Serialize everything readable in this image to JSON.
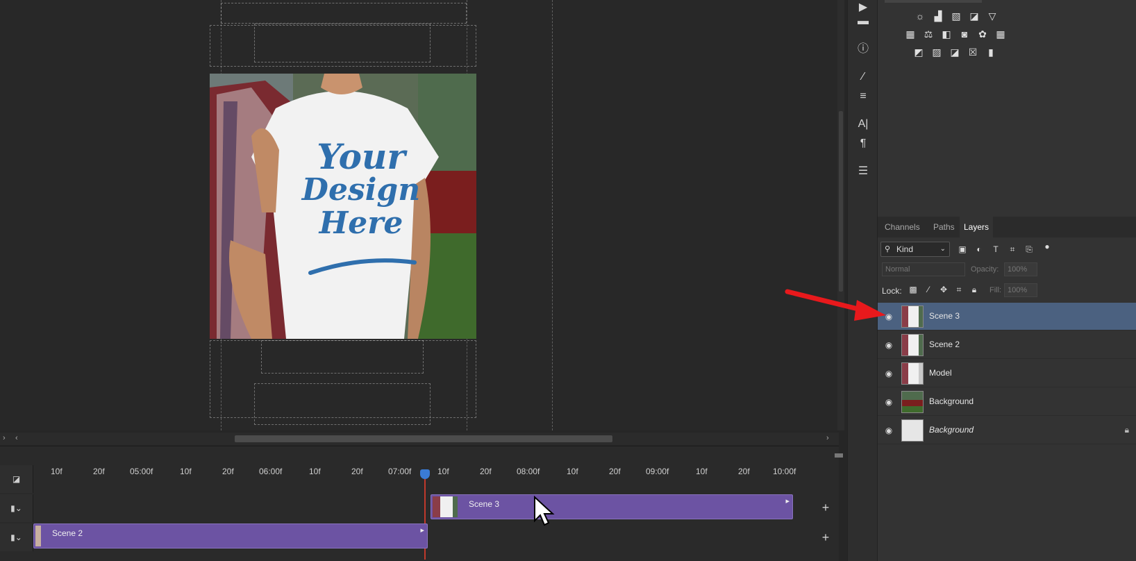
{
  "tools": {
    "icons": [
      "play-icon",
      "comment-icon",
      "info-icon",
      "brush-icon",
      "sliders-icon",
      "character-icon",
      "paragraph-icon",
      "properties-icon"
    ],
    "character_glyph": "A|",
    "paragraph_glyph": "¶"
  },
  "panel": {
    "tabs": [
      "Channels",
      "Paths",
      "Layers"
    ],
    "active_tab": "Layers",
    "filter": {
      "label": "Kind"
    },
    "blend_mode": "Normal",
    "opacity_label": "Opacity:",
    "opacity_value": "100%",
    "fill_label": "Fill:",
    "fill_value": "100%",
    "lock_label": "Lock:"
  },
  "layers": [
    {
      "name": "Scene 3",
      "selected": true,
      "visible": true
    },
    {
      "name": "Scene 2",
      "selected": false,
      "visible": true
    },
    {
      "name": "Model",
      "selected": false,
      "visible": true
    },
    {
      "name": "Background",
      "selected": false,
      "visible": true
    },
    {
      "name": "Background",
      "selected": false,
      "visible": true,
      "italic": true,
      "locked": true
    }
  ],
  "artwork": {
    "line1": "Your",
    "line2": "Design",
    "line3": "Here"
  },
  "timeline": {
    "ticks": [
      "10f",
      "20f",
      "05:00f",
      "10f",
      "20f",
      "06:00f",
      "10f",
      "20f",
      "07:00f",
      "10f",
      "20f",
      "08:00f",
      "10f",
      "20f",
      "09:00f",
      "10f",
      "20f",
      "10:00f"
    ],
    "clips": [
      {
        "name": "Scene 3"
      },
      {
        "name": "Scene 2"
      }
    ]
  },
  "colors": {
    "accent": "#4b6180",
    "clip": "#6c53a3",
    "arrow": "#e8191c",
    "design_text": "#2f6fad"
  }
}
